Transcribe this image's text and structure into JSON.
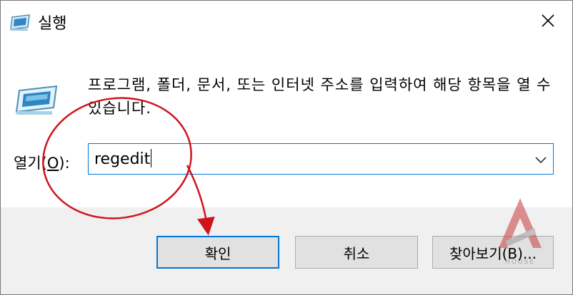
{
  "window": {
    "title": "실행"
  },
  "prompt": {
    "description": "프로그램, 폴더, 문서, 또는 인터넷 주소를 입력하여 해당 항목을 열 수 있습니다."
  },
  "open": {
    "label_prefix": "열기(",
    "label_key": "O",
    "label_suffix": "):",
    "value": "regedit"
  },
  "buttons": {
    "ok": "확인",
    "cancel": "취소",
    "browse": "찾아보기(B)..."
  },
  "watermark": {
    "text": "HOUSE"
  },
  "colors": {
    "accent": "#0078d7",
    "annotation": "#d0141e",
    "footer_bg": "#f0f0f0"
  }
}
